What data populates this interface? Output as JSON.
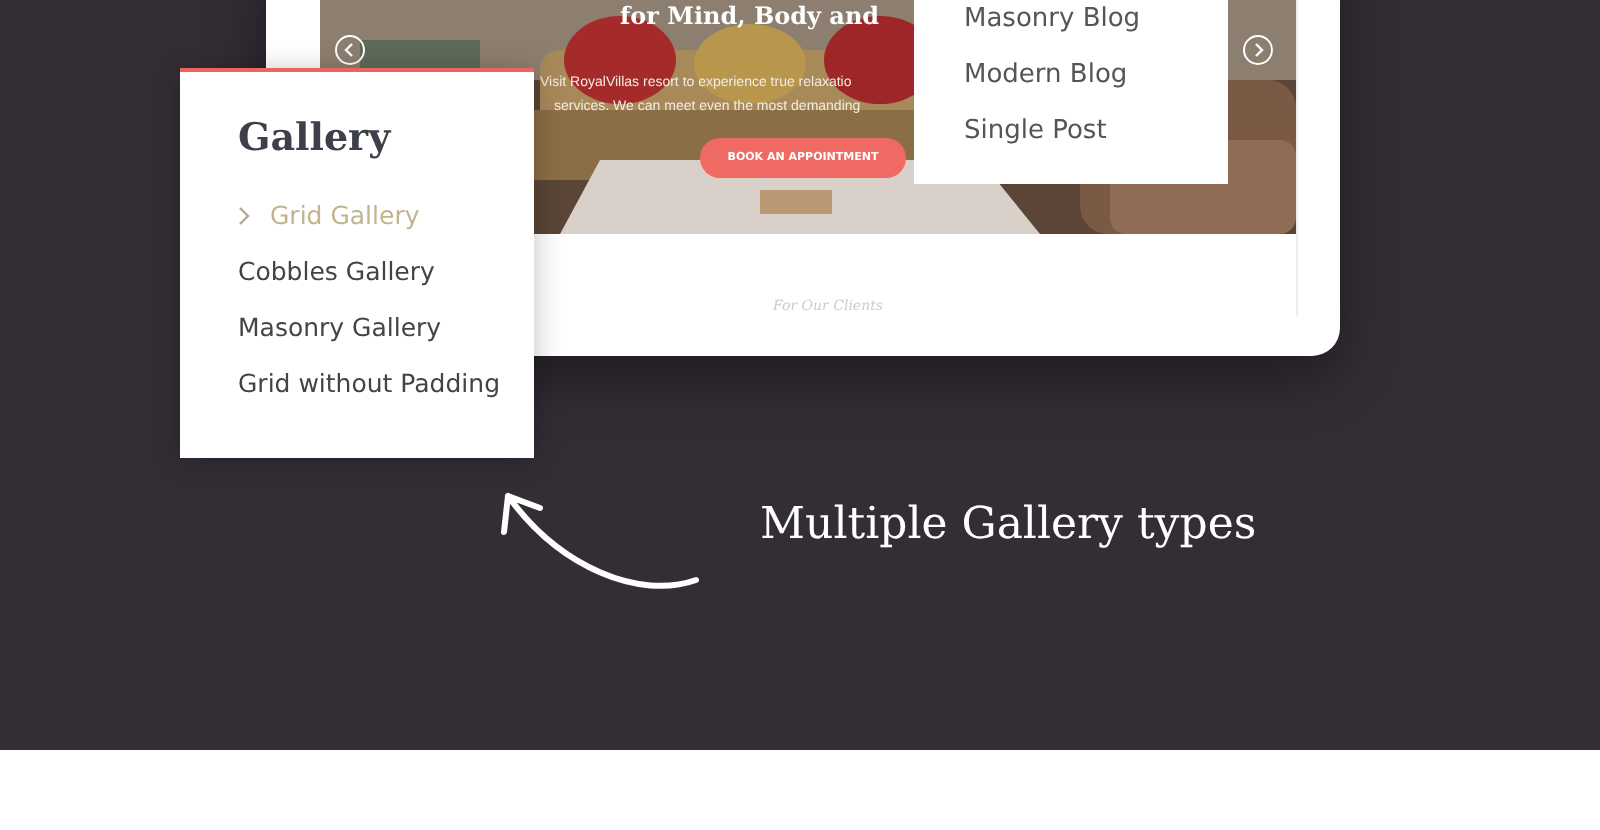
{
  "hero": {
    "heading": "for Mind, Body and",
    "text_lines": [
      "Visit RoyalVillas resort to experience true relaxatio",
      "services. We can meet even the most demanding"
    ],
    "button": "BOOK AN APPOINTMENT"
  },
  "section_heading": "For Our Clients",
  "blog_menu": {
    "items": [
      {
        "label": "Masonry Blog"
      },
      {
        "label": "Modern Blog"
      },
      {
        "label": "Single Post"
      }
    ]
  },
  "gallery_menu": {
    "title": "Gallery",
    "items": [
      {
        "label": "Grid Gallery",
        "selected": true
      },
      {
        "label": "Cobbles Gallery",
        "selected": false
      },
      {
        "label": "Masonry Gallery",
        "selected": false
      },
      {
        "label": "Grid without Padding",
        "selected": false
      }
    ]
  },
  "caption": "Multiple Gallery types"
}
